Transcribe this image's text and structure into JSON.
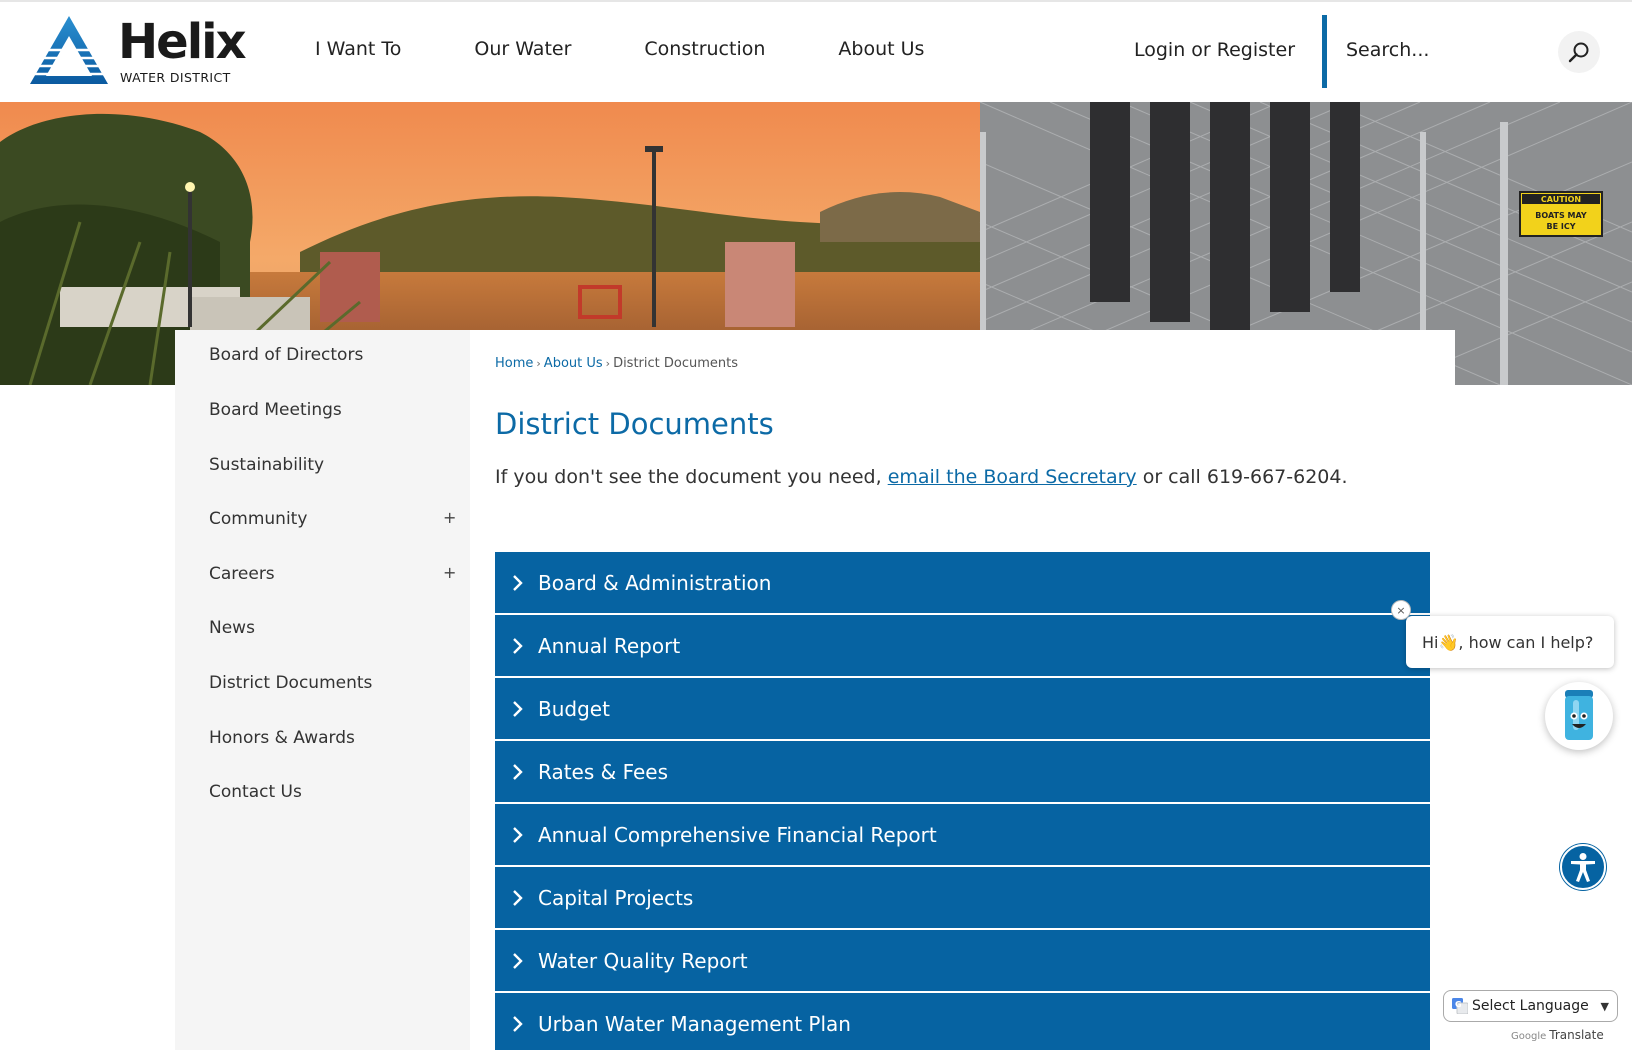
{
  "header": {
    "logo_name": "Helix",
    "logo_sub": "WATER DISTRICT",
    "nav": [
      "I Want To",
      "Our Water",
      "Construction",
      "About Us"
    ],
    "login": "Login or Register",
    "search_placeholder": "Search..."
  },
  "sidebar": {
    "items": [
      {
        "label": "Board of Directors"
      },
      {
        "label": "Board Meetings"
      },
      {
        "label": "Sustainability"
      },
      {
        "label": "Community",
        "expand": "+"
      },
      {
        "label": "Careers",
        "expand": "+"
      },
      {
        "label": "News"
      },
      {
        "label": "District Documents"
      },
      {
        "label": "Honors & Awards"
      },
      {
        "label": "Contact Us"
      }
    ]
  },
  "breadcrumb": {
    "home": "Home",
    "about": "About Us",
    "current": "District Documents",
    "sep": "›"
  },
  "main": {
    "title": "District Documents",
    "intro_before": "If you don't see the document you need, ",
    "intro_link": "email the Board Secretary",
    "intro_after": " or call 619-667-6204.",
    "accordion": [
      "Board & Administration",
      "Annual Report",
      "Budget",
      "Rates & Fees",
      "Annual Comprehensive Financial Report",
      "Capital Projects",
      "Water Quality Report",
      "Urban Water Management Plan"
    ]
  },
  "hero": {
    "sign_line1": "CAUTION",
    "sign_line2": "BOATS MAY",
    "sign_line3": "BE ICY"
  },
  "chat": {
    "close": "×",
    "greeting_before": "Hi ",
    "greeting_emoji": "👋",
    "greeting_after": ", how can I help?"
  },
  "translate": {
    "select_label": "Select Language",
    "powered_by": "Google",
    "translate_word": "Translate"
  },
  "colors": {
    "brand_blue": "#0663a2",
    "link_blue": "#0c6aa6",
    "sidebar_bg": "#f5f5f5"
  }
}
